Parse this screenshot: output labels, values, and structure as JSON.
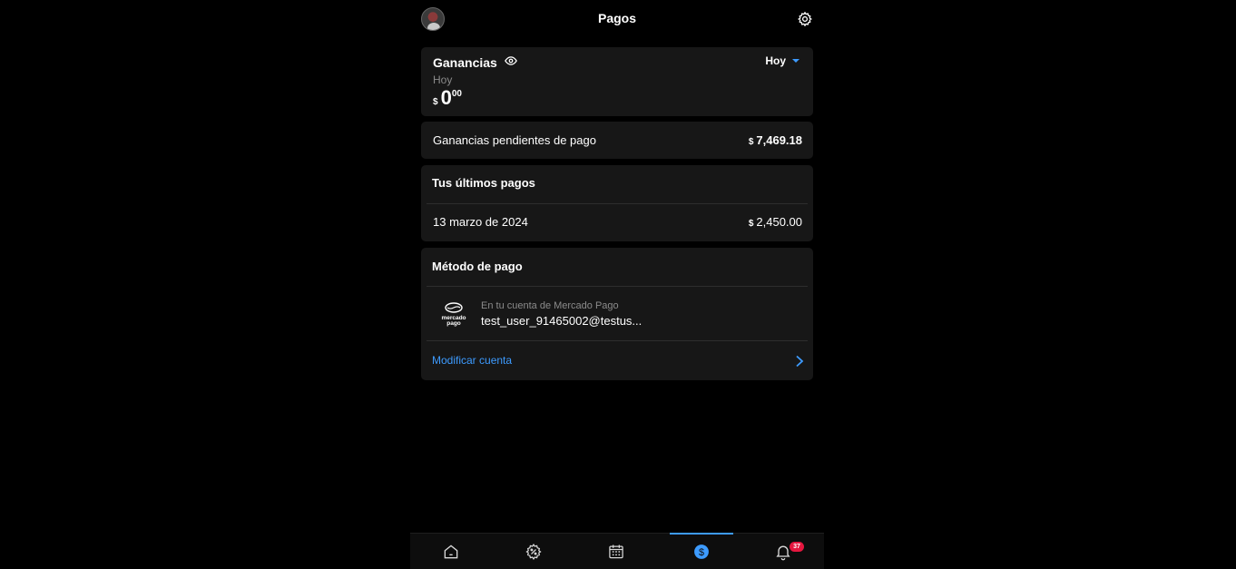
{
  "header": {
    "title": "Pagos",
    "avatar_icon": "avatar",
    "settings_icon": "gear-icon"
  },
  "earnings": {
    "title": "Ganancias",
    "visibility_icon": "eye-icon",
    "period_selector": "Hoy",
    "period_label": "Hoy",
    "currency": "$",
    "amount_int": "0",
    "amount_dec": "00"
  },
  "pending": {
    "label": "Ganancias pendientes de pago",
    "currency": "$",
    "value": "7,469.18"
  },
  "last_payments": {
    "title": "Tus últimos pagos",
    "items": [
      {
        "date": "13 marzo de 2024",
        "currency": "$",
        "amount": "2,450.00"
      }
    ]
  },
  "payment_method": {
    "title": "Método de pago",
    "logo_text": [
      "mercado",
      "pago"
    ],
    "account_label": "En tu cuenta de Mercado Pago",
    "account_user": "test_user_91465002@testus...",
    "modify_label": "Modificar cuenta"
  },
  "bottom_nav": {
    "items": [
      {
        "name": "home",
        "icon": "home-icon"
      },
      {
        "name": "promotions",
        "icon": "discount-gear-icon"
      },
      {
        "name": "calendar",
        "icon": "calendar-icon"
      },
      {
        "name": "payments",
        "icon": "dollar-circle-icon",
        "active": true
      },
      {
        "name": "notifications",
        "icon": "bell-icon",
        "badge": "37"
      }
    ]
  },
  "colors": {
    "background": "#000000",
    "card": "#171717",
    "accent": "#3d9bff",
    "badge": "#e5173f",
    "muted_text": "#8b8b8b"
  }
}
